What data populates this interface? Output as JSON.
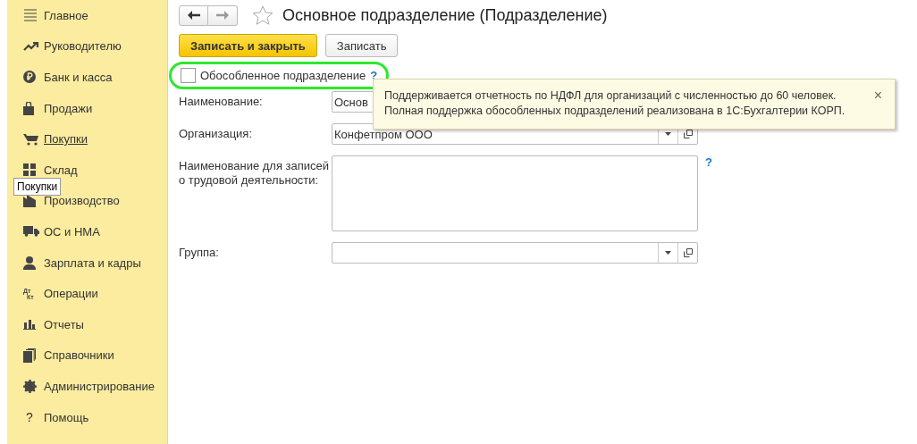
{
  "sidebar": {
    "items": [
      {
        "label": "Главное",
        "kind": "menu",
        "selected": false
      },
      {
        "label": "Руководителю",
        "kind": "trend",
        "selected": false
      },
      {
        "label": "Банк и касса",
        "kind": "ruble",
        "selected": false
      },
      {
        "label": "Продажи",
        "kind": "bag",
        "selected": false
      },
      {
        "label": "Покупки",
        "kind": "cart",
        "selected": true
      },
      {
        "label": "Склад",
        "kind": "grid",
        "selected": false
      },
      {
        "label": "Производство",
        "kind": "factory",
        "selected": false
      },
      {
        "label": "ОС и НМА",
        "kind": "truck",
        "selected": false
      },
      {
        "label": "Зарплата и кадры",
        "kind": "person",
        "selected": false
      },
      {
        "label": "Операции",
        "kind": "dtkt",
        "selected": false
      },
      {
        "label": "Отчеты",
        "kind": "bars",
        "selected": false
      },
      {
        "label": "Справочники",
        "kind": "books",
        "selected": false
      },
      {
        "label": "Администрирование",
        "kind": "gear",
        "selected": false
      },
      {
        "label": "Помощь",
        "kind": "help",
        "selected": false
      }
    ],
    "tooltip": "Покупки",
    "dtkt": [
      "Дт",
      "Кт"
    ],
    "help_glyph": "?"
  },
  "header": {
    "title": "Основное подразделение (Подразделение)",
    "favorite": false
  },
  "buttons": [
    {
      "label": "Записать и закрыть",
      "kind": "primary"
    },
    {
      "label": "Записать",
      "kind": "default"
    }
  ],
  "checkbox": {
    "label": "Обособленное подразделение",
    "checked": false,
    "help": "?",
    "highlighted": true
  },
  "fields": [
    {
      "label": "Наименование:",
      "kind": "text",
      "value": "Основ"
    },
    {
      "label": "Организация:",
      "kind": "select",
      "value": "Конфетпром ООО"
    },
    {
      "label": "Наименование для записей\nо трудовой деятельности:",
      "kind": "textarea",
      "help": "?"
    },
    {
      "label": "Группа:",
      "kind": "select"
    }
  ],
  "notification": {
    "lines": [
      "Поддерживается отчетность по НДФЛ для организаций с численностью до 60 человек.",
      "Полная поддержка обособленных подразделений реализована в 1С:Бухгалтерии КОРП."
    ],
    "close": "×"
  }
}
